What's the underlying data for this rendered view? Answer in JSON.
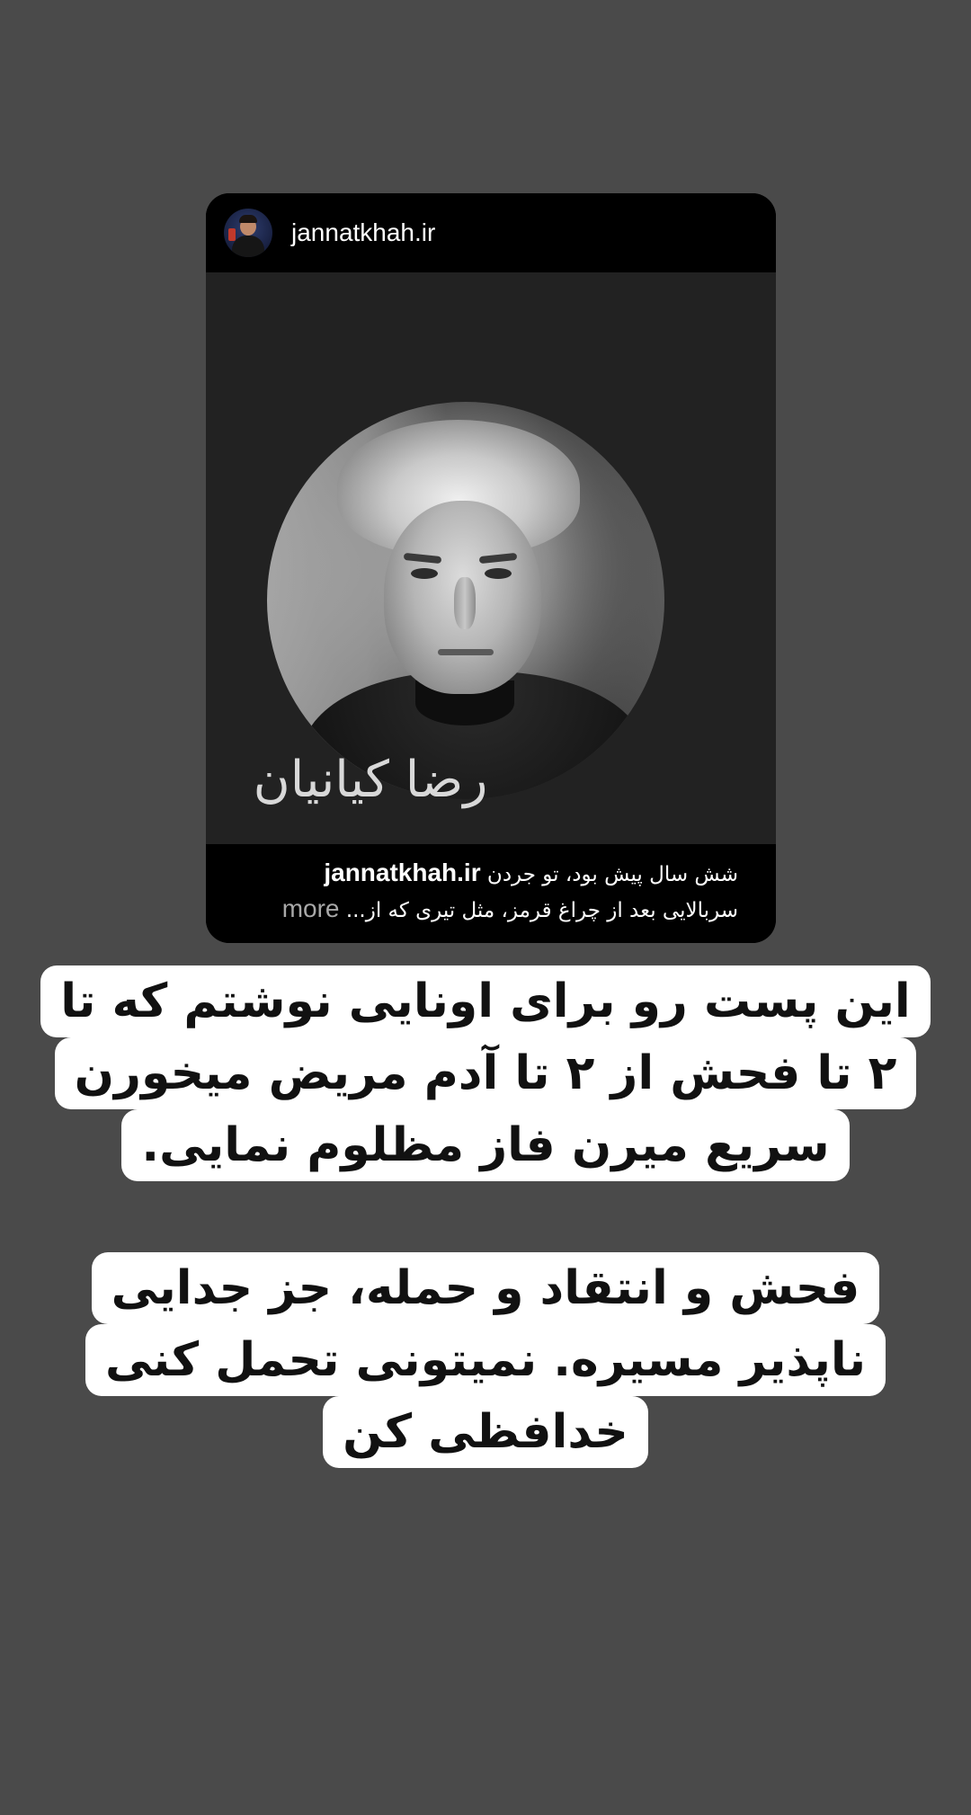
{
  "post": {
    "username": "jannatkhah.ir",
    "image_caption": "رضا کیانیان",
    "caption_user": "jannatkhah.ir",
    "caption_line1": "شش سال پیش بود، تو جردن",
    "caption_line2": "سربالایی بعد از چراغ قرمز، مثل تیری که از...",
    "more_label": "more"
  },
  "story_text": {
    "block1": [
      "این پست رو برای اونایی نوشتم که تا",
      "۲ تا فحش از ۲ تا آدم مریض میخورن",
      "سریع میرن فاز مظلوم نمایی."
    ],
    "block2": [
      "فحش و انتقاد و حمله، جز جدایی",
      "ناپذیر مسیره. نمیتونی تحمل کنی",
      "خدافظی کن"
    ]
  },
  "colors": {
    "background": "#4a4a4a",
    "card": "#000000",
    "highlight": "#ffffff",
    "text": "#111111",
    "more": "#a8a8a8"
  }
}
